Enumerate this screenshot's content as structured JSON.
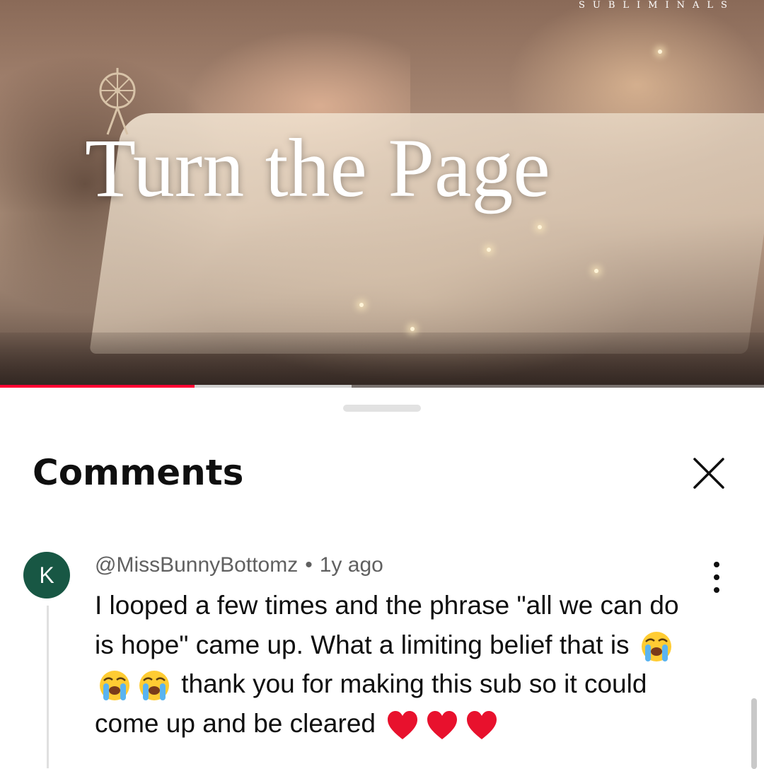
{
  "video": {
    "brand_text": "SUBLIMINALS",
    "title": "Turn the Page",
    "progress_played": 0.255,
    "progress_buffered": 0.46
  },
  "comments_panel": {
    "title": "Comments",
    "close_icon": "close-icon"
  },
  "comments": [
    {
      "avatar_letter": "K",
      "avatar_color": "#185744",
      "author": "@MissBunnyBottomz",
      "separator": "•",
      "time": "1y ago",
      "text_part1": "I looped a few times and the phrase \"all we can do is hope\" came up. What a limiting belief that is",
      "emoji_a": "loudly-crying-face-emoji",
      "text_part2": "thank you for making this sub so it could come up and be cleared",
      "emoji_b": "red-heart-emoji"
    }
  ],
  "colors": {
    "progress_red": "#ff0033",
    "heart_red": "#e8112d",
    "text_primary": "#0f0f0f",
    "text_secondary": "#606060"
  }
}
